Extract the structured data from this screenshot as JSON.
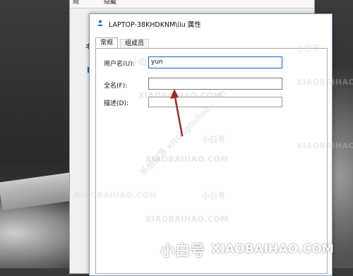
{
  "parent_dialog": {
    "tabs": [
      "规",
      "隐藏"
    ],
    "left_label": "本"
  },
  "dialog": {
    "title": "LAPTOP-38KHDKNM\\liu 属性",
    "tabs": [
      {
        "label": "常规",
        "active": true
      },
      {
        "label": "组成员",
        "active": false
      }
    ],
    "fields": {
      "username_label": "用户名(U):",
      "username_value": "yun",
      "fullname_label": "全名(F):",
      "fullname_value": "",
      "description_label": "描述(D):",
      "description_value": ""
    }
  },
  "annotation": {
    "arrow_color": "#9b2d2d"
  },
  "watermark": {
    "brand_cn": "小白号",
    "site": "XIAOBAIHAO.COM",
    "diagonal": "系统部落 xitongbuluo.com"
  },
  "banner": {
    "brand_cn": "小白号",
    "url": "XIAOBAIHAO.COM"
  }
}
